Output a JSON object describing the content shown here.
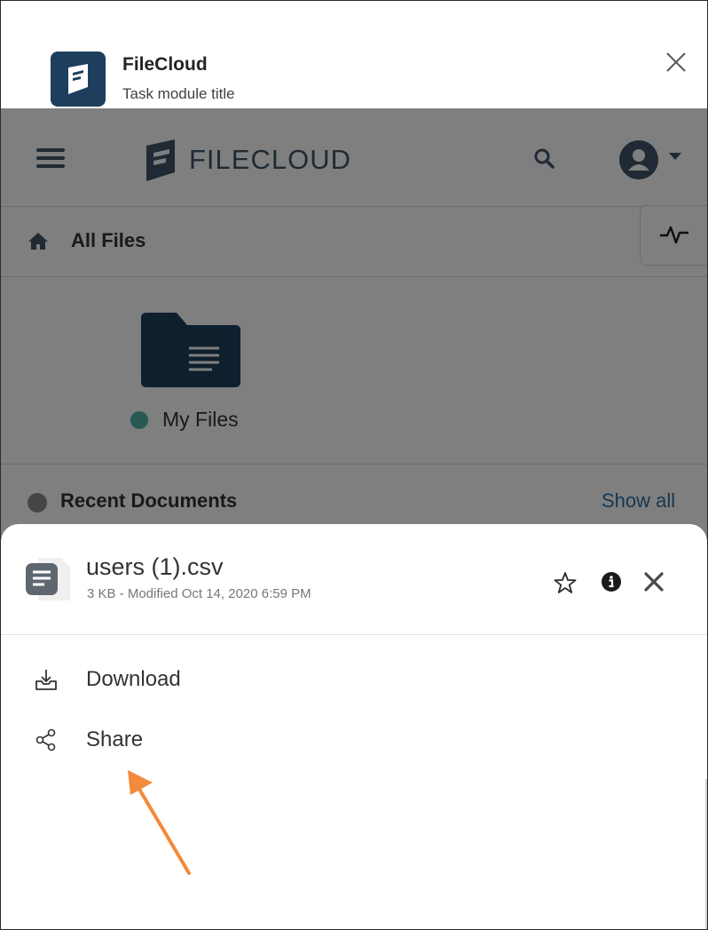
{
  "task_module": {
    "app_name": "FileCloud",
    "subtitle": "Task module title"
  },
  "topbar": {
    "brand": "FILECLOUD"
  },
  "breadcrumb": {
    "label": "All Files"
  },
  "folder": {
    "label": "My Files"
  },
  "recent": {
    "label": "Recent Documents",
    "show_all": "Show all"
  },
  "file_sheet": {
    "file_name": "users (1).csv",
    "meta": "3 KB - Modified Oct 14, 2020 6:59 PM",
    "actions": [
      {
        "label": "Download",
        "icon": "download-icon"
      },
      {
        "label": "Share",
        "icon": "share-icon"
      }
    ]
  },
  "colors": {
    "brand_navy": "#1d3f5d",
    "accent_blue": "#2d6ea3",
    "annotation_arrow": "#f28a3c",
    "status_teal": "#4fb3a3"
  }
}
